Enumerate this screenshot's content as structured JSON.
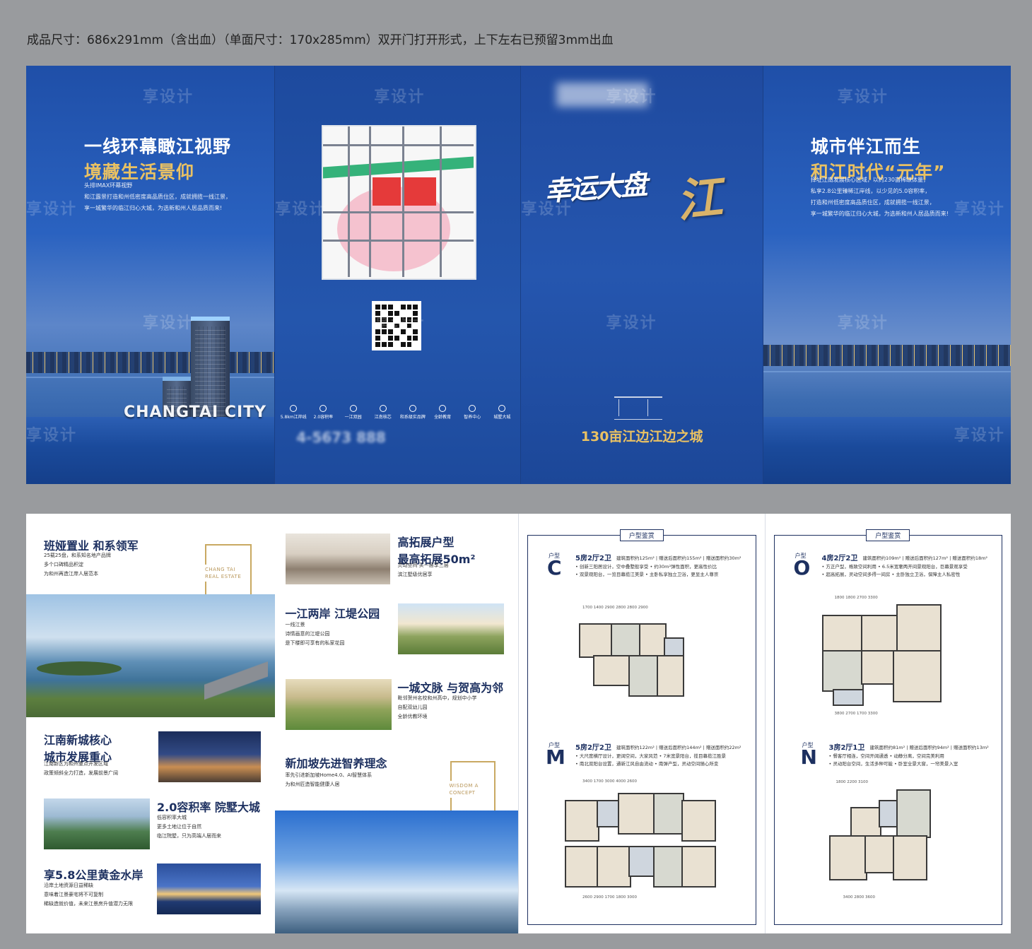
{
  "spec": "成品尺寸：686x291mm（含出血）（单面尺寸：170x285mm）双开门打开形式，上下左右已预留3mm出血",
  "watermark": "享设计",
  "outside": {
    "left": {
      "title1": "一线环幕瞰江视野",
      "title2": "境藏生活景仰",
      "sub1": "头排IMAX环幕视野",
      "sub2": "和江露景打造和州低密度高品质住区，成就拥揽一线江景，",
      "sub3": "享一城繁华的临江归心大城，为选新和州人居品质而来!",
      "brand": "CHANGTAI CITY"
    },
    "map": {
      "features": [
        "5.8km江岸线",
        "2.0容积率",
        "一江双园",
        "江南核芯",
        "和系级实品牌",
        "全龄教育",
        "智养中心",
        "城墅大城"
      ],
      "phone": "4-5673 888"
    },
    "cover": {
      "calligraphy": "幸运大盘",
      "calligraphy_big": "江",
      "tagline": "130亩江边江边之城"
    },
    "right": {
      "title1": "城市伴江而生",
      "title2": "和江时代“元年”",
      "sub1": "择址江南发展核心区域，以约230亩稀缺体量，",
      "sub2": "私享2.8公里臻稀江岸线，以少见的5.0容积率，",
      "sub3": "打造和州低密度高品质住区，成就拥揽一线江景，",
      "sub4": "享一城繁华的临江归心大城，为选新和州人居品质而来!"
    }
  },
  "inside": {
    "p1": {
      "h1": "班娅置业 和系领军",
      "t1a": "25载25盘，和系知名地产品牌",
      "t1b": "多个口碑精品积淀",
      "t1c": "为和州再造江岸人居范本",
      "frame_label1": "CHANG TAI",
      "frame_label2": "REAL ESTATE",
      "h2a": "江南新城核心",
      "h2b": "城市发展重心",
      "t2a": "江南新区为和州重点开发区域",
      "t2b": "政策倾斜全力打造，发展前景广阔",
      "h3": "2.0容积率 院墅大城",
      "t3a": "低容积率大城",
      "t3b": "更多土地让位于自然",
      "t3c": "临江院墅，只为高端人居而来",
      "h4": "享5.8公里黄金水岸",
      "t4a": "沿岸土地资源日益稀缺",
      "t4b": "意味着江景豪宅将不可复制",
      "t4c": "稀缺造就价值，未来江景房升值潜力无限"
    },
    "p2": {
      "h1a": "高拓展户型",
      "h1b": "最高拓展50m²",
      "t1a": "灵动空间 买一层享三层",
      "t1b": "滨江墅级优居享",
      "h2": "一江两岸 江堤公园",
      "t2a": "一线江景",
      "t2b": "诗情画意的江堤公园",
      "t2c": "是下楼即可享有的私家花园",
      "h3": "一城文脉 与贺高为邻",
      "t3a": "毗邻贺州名校和州高中，规划中小学",
      "t3b": "自配双幼儿园",
      "t3c": "全龄优教环境",
      "h4": "新加坡先进智养理念",
      "t4a": "率先引进新加坡Home4.0、AI智慧体系",
      "t4b": "为和州匠造智能健康人居",
      "frame_label1": "WISDOM A",
      "frame_label2": "CONCEPT"
    },
    "plans": {
      "badge": "户型鉴赏",
      "type_label": "户型",
      "C": {
        "letter": "C",
        "title": "5房2厅2卫",
        "area": "建筑面积约125m² | 赠送后面积约155m² | 赠送面积约30m²",
        "b1": "• 创新三阳居设计，空中叠墅般享受   • 约30m²弹性面积，更高性价比",
        "b2": "• 双景观阳台，一览目幕揽江美景   • 主卧私享独立卫浴，更显主人尊崇"
      },
      "M": {
        "letter": "M",
        "title": "5房2厅2卫",
        "area": "建筑面积约122m² | 赠送后面积约144m² | 赠送面积约22m²",
        "b1": "• 大尺度横厅设计，更阔空间，大家风范   • 7米宽景阳台，揽目幕揽江胜景",
        "b2": "• 南北双阳台设置，通新江风自由流动   • 南弹产型，灵动空间随心所变"
      },
      "O": {
        "letter": "O",
        "title": "4房2厅2卫",
        "area": "建筑面积约109m² | 赠送后面积约127m² | 赠送面积约18m²",
        "b1": "• 方正户型，格致空间利用   • 6.5米宽奢两开间景观阳台，巨幕景观享受",
        "b2": "• 超高拓展，灵动空间多得一间房   • 主卧独立卫浴，保障主人私密性"
      },
      "N": {
        "letter": "N",
        "title": "3房2厅1卫",
        "area": "建筑面积约81m² | 赠送后面积约94m² | 赠送面积约13m²",
        "b1": "• 餐客厅相连，空间开阔通透   • 动静分离，空间完美利用",
        "b2": "• 灵动阳台空间，生活多种可能   • 卧室全景大窗，一帘美景入室"
      }
    }
  }
}
